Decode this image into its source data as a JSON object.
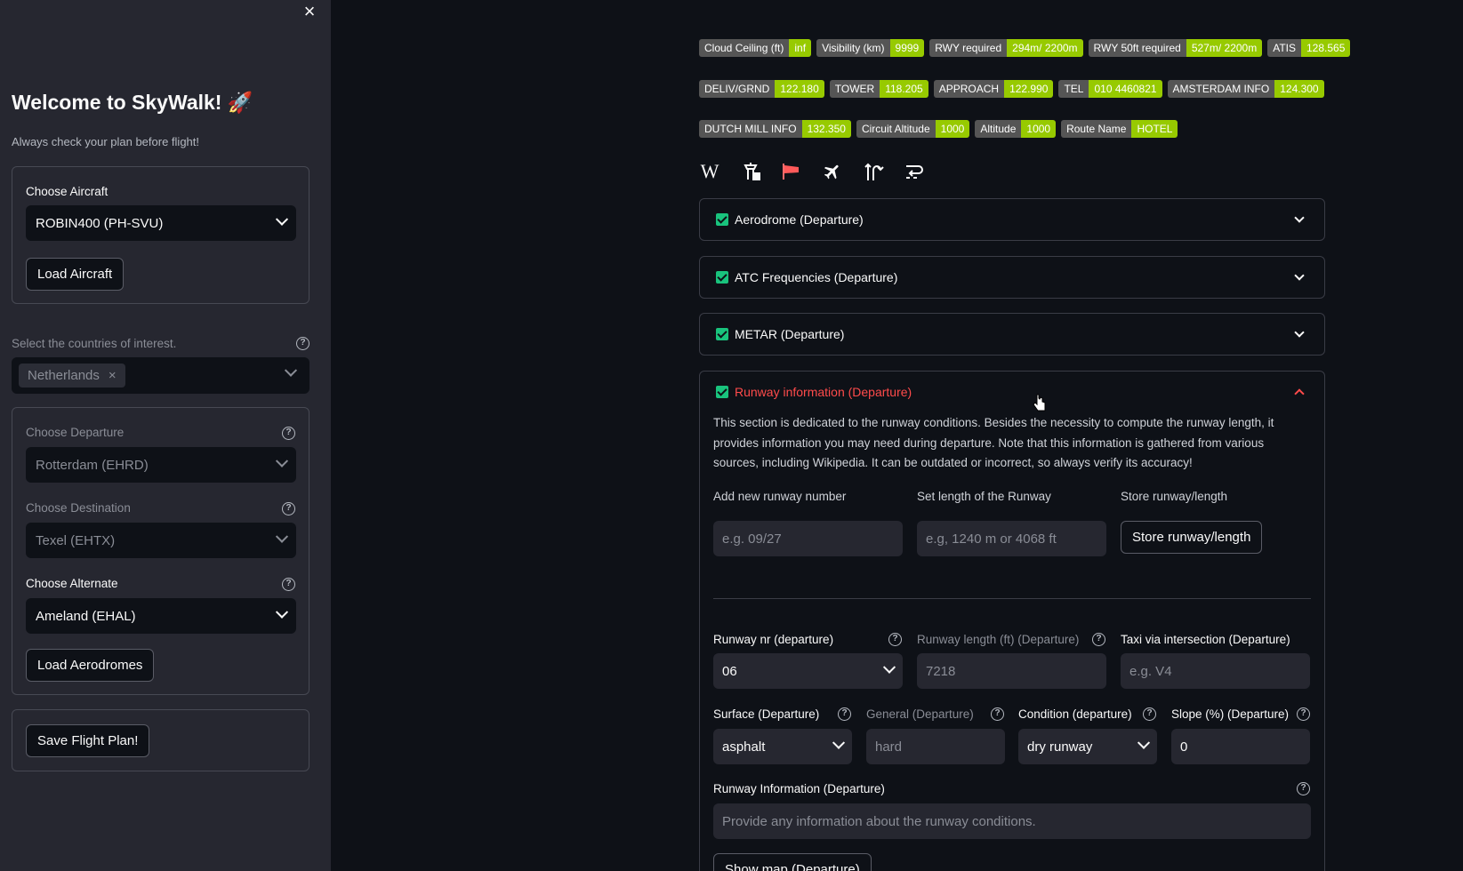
{
  "sidebar": {
    "close": "×",
    "title": "Welcome to SkyWalk! 🚀",
    "subtitle": "Always check your plan before flight!",
    "aircraft_label": "Choose Aircraft",
    "aircraft_value": "ROBIN400 (PH-SVU)",
    "load_aircraft": "Load Aircraft",
    "countries_label": "Select the countries of interest.",
    "country_tag": "Netherlands",
    "tag_remove": "×",
    "departure_label": "Choose Departure",
    "departure_value": "Rotterdam (EHRD)",
    "destination_label": "Choose Destination",
    "destination_value": "Texel (EHTX)",
    "alternate_label": "Choose Alternate",
    "alternate_value": "Ameland (EHAL)",
    "load_aerodromes": "Load Aerodromes",
    "save_plan": "Save Flight Plan!",
    "help": "?"
  },
  "badges": [
    [
      {
        "k": "Cloud Ceiling (ft)",
        "v": "inf"
      },
      {
        "k": "Visibility (km)",
        "v": "9999"
      },
      {
        "k": "RWY required",
        "v": "294m/ 2200m"
      },
      {
        "k": "RWY 50ft required",
        "v": "527m/ 2200m"
      },
      {
        "k": "ATIS",
        "v": "128.565"
      }
    ],
    [
      {
        "k": "DELIV/GRND",
        "v": "122.180"
      },
      {
        "k": "TOWER",
        "v": "118.205"
      },
      {
        "k": "APPROACH",
        "v": "122.990"
      },
      {
        "k": "TEL",
        "v": "010 4460821"
      },
      {
        "k": "AMSTERDAM INFO",
        "v": "124.300"
      }
    ],
    [
      {
        "k": "DUTCH MILL INFO",
        "v": "132.350"
      },
      {
        "k": "Circuit Altitude",
        "v": "1000"
      },
      {
        "k": "Altitude",
        "v": "1000"
      },
      {
        "k": "Route Name",
        "v": "HOTEL"
      }
    ]
  ],
  "toolbar_icons": [
    "wikipedia-icon",
    "control-tower-icon",
    "windsock-icon",
    "airplane-icon",
    "runway-turn-icon",
    "route-return-icon"
  ],
  "wiki_glyph": "W",
  "sections": {
    "aerodrome": "Aerodrome (Departure)",
    "atc": "ATC Frequencies (Departure)",
    "metar": "METAR (Departure)",
    "runway": "Runway information (Departure)"
  },
  "runway": {
    "description": "This section is dedicated to the runway conditions. Besides the necessity to compute the runway length, it provides information you may need during departure. Note that this information is gathered from various sources, including Wikipedia. It can be outdated or incorrect, so always verify its accuracy!",
    "add_label": "Add new runway number",
    "add_placeholder": "e.g. 09/27",
    "length_label": "Set length of the Runway",
    "length_placeholder": "e.g, 1240 m or 4068 ft",
    "store_label": "Store runway/length",
    "store_button": "Store runway/length",
    "nr_label": "Runway nr (departure)",
    "nr_value": "06",
    "rlen_label": "Runway length (ft) (Departure)",
    "rlen_value": "7218",
    "taxi_label": "Taxi via intersection (Departure)",
    "taxi_placeholder": "e.g. V4",
    "surface_label": "Surface (Departure)",
    "surface_value": "asphalt",
    "general_label": "General (Departure)",
    "general_value": "hard",
    "condition_label": "Condition (departure)",
    "condition_value": "dry runway",
    "slope_label": "Slope (%) (Departure)",
    "slope_value": "0",
    "info_label": "Runway Information (Departure)",
    "info_placeholder": "Provide any information about the runway conditions.",
    "show_map": "Show map (Departure)"
  },
  "colors": {
    "accent": "#ff4b4b",
    "badge_value": "#97ca00",
    "check": "#19c37d"
  }
}
